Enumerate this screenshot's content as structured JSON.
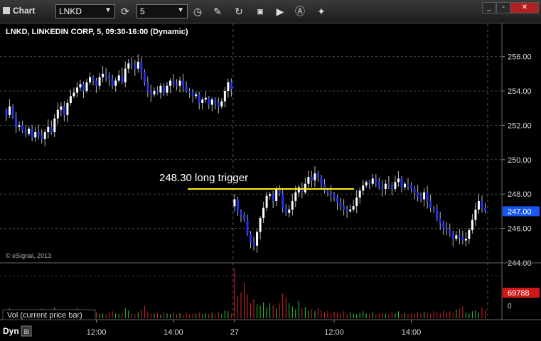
{
  "toolbar": {
    "title": "Chart",
    "symbol": "LNKD",
    "interval": "5",
    "icons": [
      "refresh-icon",
      "clock-icon",
      "pencil-icon",
      "cycle-icon",
      "gci-icon",
      "play-icon",
      "a-icon",
      "wrench-icon"
    ],
    "window_buttons": [
      "minimize",
      "restore",
      "close"
    ]
  },
  "chart_header": "LNKD, LINKEDIN CORP, 5, 09:30-16:00 (Dynamic)",
  "watermark": "© eSignal, 2013",
  "annotation": {
    "text": "248.30 long trigger",
    "price": 248.3,
    "color": "#ffee00"
  },
  "last_price_label": "247.00",
  "volume_panel": {
    "label": "Vol (current price bar)",
    "last_value_label": "69788",
    "zero_label": "0"
  },
  "footer": {
    "label": "Dyn"
  },
  "chart_data": {
    "type": "candlestick",
    "title": "LNKD, LINKEDIN CORP, 5, 09:30-16:00 (Dynamic)",
    "y_ticks": [
      "256.00",
      "254.00",
      "252.00",
      "250.00",
      "248.00",
      "246.00",
      "244.00"
    ],
    "ylim": [
      244,
      257.1
    ],
    "x_ticks": [
      {
        "label": "12:00",
        "at": 28
      },
      {
        "label": "14:00",
        "at": 52
      },
      {
        "label": "27",
        "at": 71
      },
      {
        "label": "12:00",
        "at": 102
      },
      {
        "label": "14:00",
        "at": 126
      }
    ],
    "session_break": 71,
    "y_labels_only_visible": true,
    "bar_count": 150,
    "colors": {
      "up": "#ffffff",
      "down": "#2233ee",
      "vol_up": "#33cc33",
      "vol_down": "#dd2222",
      "trigger": "#ffee00",
      "last_price_bg": "#1a56f0",
      "vol_last_bg": "#d01818"
    },
    "closes": [
      252.6,
      253.1,
      252.5,
      251.9,
      252.0,
      251.7,
      251.5,
      251.8,
      251.3,
      251.6,
      251.4,
      251.2,
      251.6,
      251.9,
      251.6,
      252.4,
      252.9,
      253.1,
      252.6,
      253.3,
      253.7,
      253.9,
      254.2,
      254.4,
      254.0,
      254.5,
      254.8,
      254.6,
      254.3,
      254.8,
      255.0,
      254.9,
      254.7,
      254.3,
      254.6,
      254.9,
      254.5,
      255.3,
      255.6,
      255.5,
      255.3,
      255.7,
      255.1,
      254.5,
      254.0,
      253.8,
      254.0,
      253.9,
      254.3,
      253.9,
      254.3,
      254.6,
      254.4,
      254.3,
      254.6,
      254.3,
      254.0,
      253.9,
      253.7,
      253.8,
      253.3,
      253.5,
      253.6,
      253.2,
      253.5,
      253.3,
      253.1,
      253.4,
      254.0,
      254.5,
      254.1,
      247.7,
      247.0,
      246.8,
      246.5,
      245.7,
      245.2,
      245.0,
      245.8,
      246.6,
      247.2,
      247.9,
      248.0,
      247.6,
      248.3,
      248.0,
      247.2,
      246.9,
      247.1,
      247.6,
      248.1,
      248.4,
      248.1,
      248.6,
      249.0,
      248.8,
      249.2,
      249.0,
      248.6,
      248.2,
      248.1,
      248.0,
      247.8,
      247.5,
      247.3,
      247.1,
      247.0,
      247.1,
      247.3,
      247.8,
      248.2,
      248.5,
      248.7,
      248.6,
      248.9,
      248.7,
      248.4,
      248.3,
      248.6,
      248.5,
      248.3,
      248.7,
      248.9,
      248.4,
      248.6,
      248.5,
      248.3,
      248.1,
      247.9,
      247.7,
      248.1,
      247.6,
      247.2,
      247.1,
      246.6,
      246.3,
      246.0,
      245.9,
      245.7,
      245.4,
      245.6,
      245.5,
      245.3,
      245.4,
      245.9,
      246.5,
      247.1,
      247.6,
      247.2,
      247.0
    ],
    "volume_heights": [
      0.15,
      0.2,
      0.12,
      0.1,
      0.18,
      0.09,
      0.14,
      0.1,
      0.16,
      0.11,
      0.13,
      0.2,
      0.12,
      0.1,
      0.15,
      0.22,
      0.18,
      0.1,
      0.14,
      0.12,
      0.17,
      0.09,
      0.2,
      0.11,
      0.15,
      0.1,
      0.13,
      0.16,
      0.12,
      0.09,
      0.1,
      0.08,
      0.12,
      0.14,
      0.1,
      0.09,
      0.11,
      0.2,
      0.15,
      0.1,
      0.08,
      0.12,
      0.18,
      0.25,
      0.12,
      0.1,
      0.09,
      0.11,
      0.08,
      0.13,
      0.1,
      0.09,
      0.12,
      0.08,
      0.1,
      0.07,
      0.11,
      0.08,
      0.1,
      0.09,
      0.12,
      0.08,
      0.1,
      0.09,
      0.11,
      0.08,
      0.13,
      0.09,
      0.16,
      0.14,
      0.1,
      1.0,
      0.45,
      0.52,
      0.72,
      0.48,
      0.3,
      0.38,
      0.28,
      0.25,
      0.32,
      0.22,
      0.3,
      0.26,
      0.2,
      0.3,
      0.5,
      0.42,
      0.3,
      0.24,
      0.18,
      0.35,
      0.2,
      0.22,
      0.15,
      0.18,
      0.14,
      0.2,
      0.16,
      0.12,
      0.15,
      0.1,
      0.13,
      0.11,
      0.1,
      0.14,
      0.09,
      0.12,
      0.1,
      0.08,
      0.11,
      0.14,
      0.1,
      0.09,
      0.12,
      0.08,
      0.1,
      0.11,
      0.09,
      0.08,
      0.12,
      0.1,
      0.14,
      0.09,
      0.11,
      0.08,
      0.1,
      0.09,
      0.12,
      0.1,
      0.13,
      0.11,
      0.09,
      0.14,
      0.12,
      0.1,
      0.16,
      0.12,
      0.14,
      0.11,
      0.18,
      0.2,
      0.24,
      0.12,
      0.1,
      0.14,
      0.16,
      0.12,
      0.22,
      0.18
    ]
  }
}
